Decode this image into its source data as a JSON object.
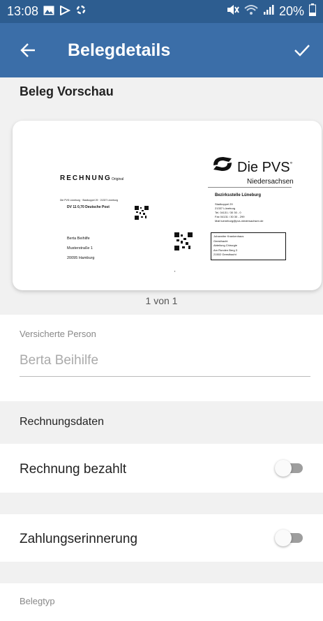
{
  "status": {
    "time": "13:08",
    "battery": "20%"
  },
  "appbar": {
    "title": "Belegdetails"
  },
  "preview": {
    "section_title": "Beleg Vorschau",
    "pager": "1 von 1",
    "doc": {
      "heading": "RECHNUNG",
      "heading_note": "Original",
      "brand": "Die PVS",
      "brand_sub": "Niedersachsen",
      "office": "Bezirksstelle Lüneburg",
      "sender_line": "Die PVS Lüneburg · Stadkoppel 29 · 21337 Lüneburg",
      "dv_line": "DV 11  0,70  Deutsche Post",
      "addr": [
        "Stadkoppel 29",
        "21337 Lüneburg",
        "Tel. 04131 / 30 30 - 0",
        "Fax 04131 / 30 30 - 299",
        "Mail lueneburg@pvs-niedersachsen.de"
      ],
      "recipient": [
        "Berta Beihilfe",
        "Musterstraße 1",
        "20095 Hamburg"
      ],
      "box": [
        "Johanniter Krankenhaus",
        "Geesthacht",
        "Abteilung Chirurgie",
        "Am Runden Berg 3",
        "21502 Geesthacht"
      ]
    }
  },
  "insured": {
    "label": "Versicherte Person",
    "value": "Berta Beihilfe"
  },
  "invoice_section": {
    "title": "Rechnungsdaten"
  },
  "paid": {
    "label": "Rechnung bezahlt",
    "on": false
  },
  "reminder": {
    "label": "Zahlungserinnerung",
    "on": false
  },
  "doctype": {
    "label": "Belegtyp"
  }
}
